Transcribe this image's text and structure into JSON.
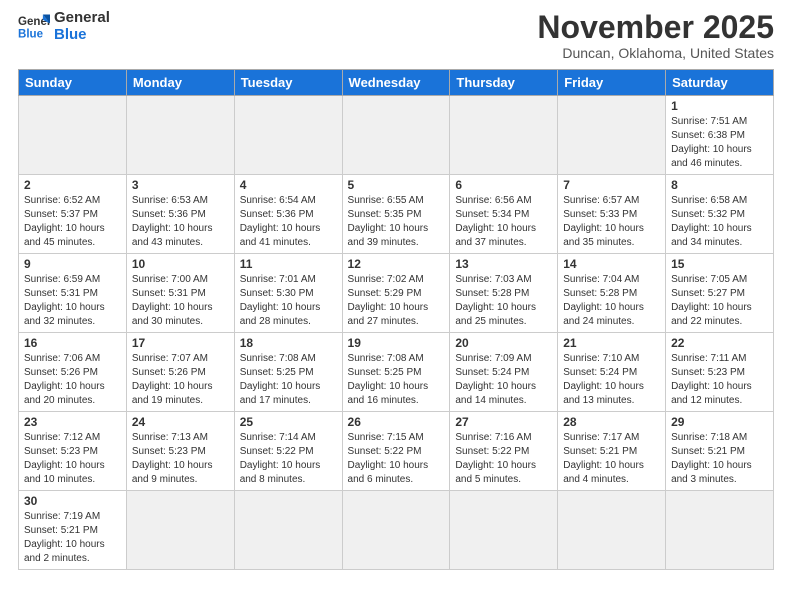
{
  "header": {
    "logo": {
      "line1": "General",
      "line2": "Blue"
    },
    "title": "November 2025",
    "location": "Duncan, Oklahoma, United States"
  },
  "weekdays": [
    "Sunday",
    "Monday",
    "Tuesday",
    "Wednesday",
    "Thursday",
    "Friday",
    "Saturday"
  ],
  "weeks": [
    [
      {
        "day": "",
        "info": ""
      },
      {
        "day": "",
        "info": ""
      },
      {
        "day": "",
        "info": ""
      },
      {
        "day": "",
        "info": ""
      },
      {
        "day": "",
        "info": ""
      },
      {
        "day": "",
        "info": ""
      },
      {
        "day": "1",
        "info": "Sunrise: 7:51 AM\nSunset: 6:38 PM\nDaylight: 10 hours and 46 minutes."
      }
    ],
    [
      {
        "day": "2",
        "info": "Sunrise: 6:52 AM\nSunset: 5:37 PM\nDaylight: 10 hours and 45 minutes."
      },
      {
        "day": "3",
        "info": "Sunrise: 6:53 AM\nSunset: 5:36 PM\nDaylight: 10 hours and 43 minutes."
      },
      {
        "day": "4",
        "info": "Sunrise: 6:54 AM\nSunset: 5:36 PM\nDaylight: 10 hours and 41 minutes."
      },
      {
        "day": "5",
        "info": "Sunrise: 6:55 AM\nSunset: 5:35 PM\nDaylight: 10 hours and 39 minutes."
      },
      {
        "day": "6",
        "info": "Sunrise: 6:56 AM\nSunset: 5:34 PM\nDaylight: 10 hours and 37 minutes."
      },
      {
        "day": "7",
        "info": "Sunrise: 6:57 AM\nSunset: 5:33 PM\nDaylight: 10 hours and 35 minutes."
      },
      {
        "day": "8",
        "info": "Sunrise: 6:58 AM\nSunset: 5:32 PM\nDaylight: 10 hours and 34 minutes."
      }
    ],
    [
      {
        "day": "9",
        "info": "Sunrise: 6:59 AM\nSunset: 5:31 PM\nDaylight: 10 hours and 32 minutes."
      },
      {
        "day": "10",
        "info": "Sunrise: 7:00 AM\nSunset: 5:31 PM\nDaylight: 10 hours and 30 minutes."
      },
      {
        "day": "11",
        "info": "Sunrise: 7:01 AM\nSunset: 5:30 PM\nDaylight: 10 hours and 28 minutes."
      },
      {
        "day": "12",
        "info": "Sunrise: 7:02 AM\nSunset: 5:29 PM\nDaylight: 10 hours and 27 minutes."
      },
      {
        "day": "13",
        "info": "Sunrise: 7:03 AM\nSunset: 5:28 PM\nDaylight: 10 hours and 25 minutes."
      },
      {
        "day": "14",
        "info": "Sunrise: 7:04 AM\nSunset: 5:28 PM\nDaylight: 10 hours and 24 minutes."
      },
      {
        "day": "15",
        "info": "Sunrise: 7:05 AM\nSunset: 5:27 PM\nDaylight: 10 hours and 22 minutes."
      }
    ],
    [
      {
        "day": "16",
        "info": "Sunrise: 7:06 AM\nSunset: 5:26 PM\nDaylight: 10 hours and 20 minutes."
      },
      {
        "day": "17",
        "info": "Sunrise: 7:07 AM\nSunset: 5:26 PM\nDaylight: 10 hours and 19 minutes."
      },
      {
        "day": "18",
        "info": "Sunrise: 7:08 AM\nSunset: 5:25 PM\nDaylight: 10 hours and 17 minutes."
      },
      {
        "day": "19",
        "info": "Sunrise: 7:08 AM\nSunset: 5:25 PM\nDaylight: 10 hours and 16 minutes."
      },
      {
        "day": "20",
        "info": "Sunrise: 7:09 AM\nSunset: 5:24 PM\nDaylight: 10 hours and 14 minutes."
      },
      {
        "day": "21",
        "info": "Sunrise: 7:10 AM\nSunset: 5:24 PM\nDaylight: 10 hours and 13 minutes."
      },
      {
        "day": "22",
        "info": "Sunrise: 7:11 AM\nSunset: 5:23 PM\nDaylight: 10 hours and 12 minutes."
      }
    ],
    [
      {
        "day": "23",
        "info": "Sunrise: 7:12 AM\nSunset: 5:23 PM\nDaylight: 10 hours and 10 minutes."
      },
      {
        "day": "24",
        "info": "Sunrise: 7:13 AM\nSunset: 5:23 PM\nDaylight: 10 hours and 9 minutes."
      },
      {
        "day": "25",
        "info": "Sunrise: 7:14 AM\nSunset: 5:22 PM\nDaylight: 10 hours and 8 minutes."
      },
      {
        "day": "26",
        "info": "Sunrise: 7:15 AM\nSunset: 5:22 PM\nDaylight: 10 hours and 6 minutes."
      },
      {
        "day": "27",
        "info": "Sunrise: 7:16 AM\nSunset: 5:22 PM\nDaylight: 10 hours and 5 minutes."
      },
      {
        "day": "28",
        "info": "Sunrise: 7:17 AM\nSunset: 5:21 PM\nDaylight: 10 hours and 4 minutes."
      },
      {
        "day": "29",
        "info": "Sunrise: 7:18 AM\nSunset: 5:21 PM\nDaylight: 10 hours and 3 minutes."
      }
    ],
    [
      {
        "day": "30",
        "info": "Sunrise: 7:19 AM\nSunset: 5:21 PM\nDaylight: 10 hours and 2 minutes."
      },
      {
        "day": "",
        "info": ""
      },
      {
        "day": "",
        "info": ""
      },
      {
        "day": "",
        "info": ""
      },
      {
        "day": "",
        "info": ""
      },
      {
        "day": "",
        "info": ""
      },
      {
        "day": "",
        "info": ""
      }
    ]
  ]
}
